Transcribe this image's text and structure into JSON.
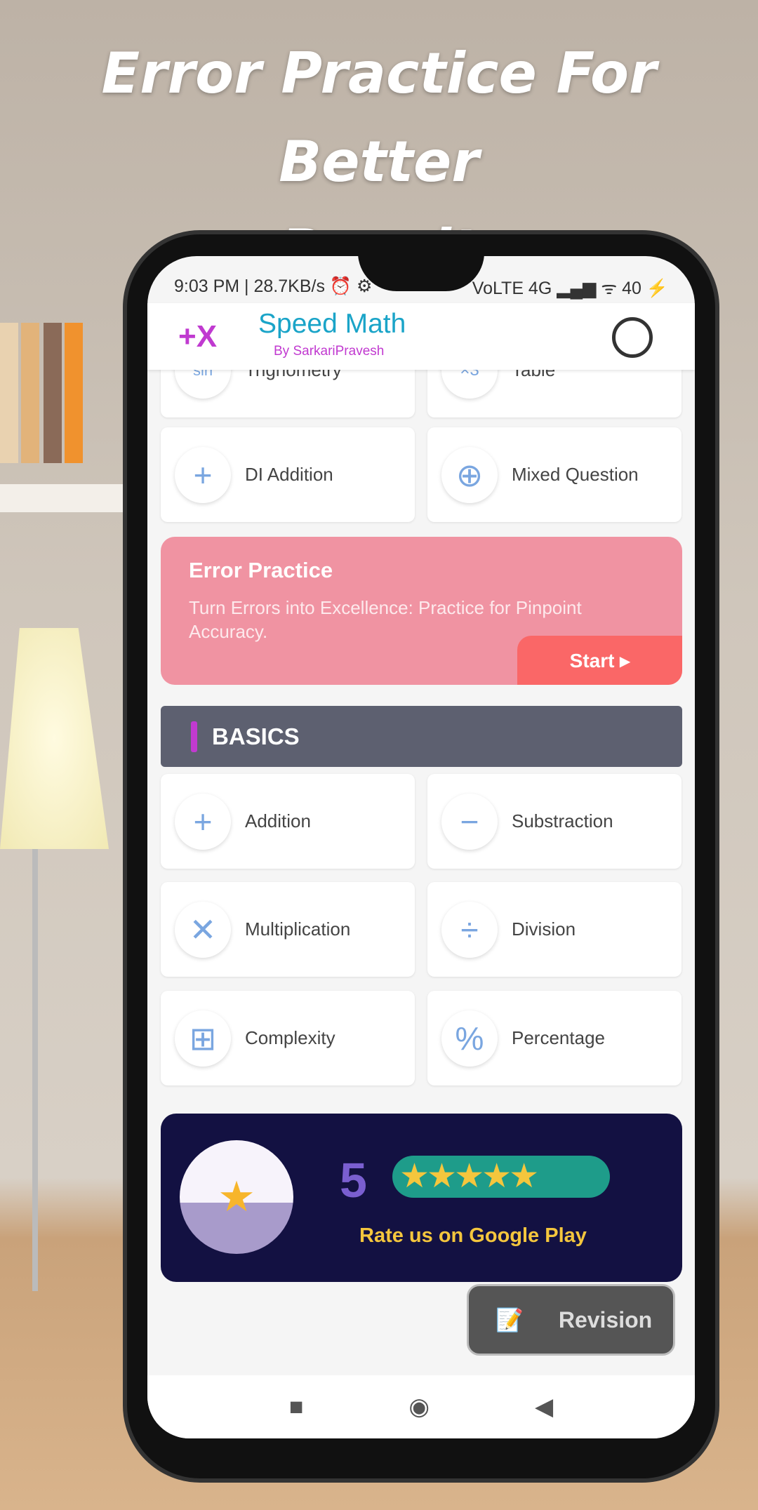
{
  "headline": {
    "line1": "Error Practice For Better",
    "line2": "Result"
  },
  "status_bar": {
    "left": "9:03 PM | 28.7KB/s ⏰ ⚙",
    "right": "VoLTE 4G ▂▄▆ ᯤ 40 ⚡",
    "battery": "40"
  },
  "app_bar": {
    "title": "Speed Math",
    "subtitle": "By SarkariPravesh",
    "logo": "+X"
  },
  "top_cards": [
    {
      "label": "Trignometry",
      "icon": "sin-icon",
      "glyph": "sin"
    },
    {
      "label": "Table",
      "icon": "table-icon",
      "glyph": "×3"
    },
    {
      "label": "DI Addition",
      "icon": "plus-icon",
      "glyph": "+"
    },
    {
      "label": "Mixed Question",
      "icon": "funnel-icon",
      "glyph": "⊕"
    }
  ],
  "error_practice": {
    "title": "Error Practice",
    "description": "Turn Errors into Excellence: Practice for Pinpoint Accuracy.",
    "start_label": "Start ▸"
  },
  "basics": {
    "header": "BASICS",
    "items": [
      {
        "label": "Addition",
        "glyph": "+"
      },
      {
        "label": "Substraction",
        "glyph": "−"
      },
      {
        "label": "Multiplication",
        "glyph": "✕"
      },
      {
        "label": "Division",
        "glyph": "÷"
      },
      {
        "label": "Complexity",
        "glyph": "⊞"
      },
      {
        "label": "Percentage",
        "glyph": "%"
      }
    ]
  },
  "banner": {
    "text": "Rate us on Google Play",
    "number": "5",
    "stars": "★★★★★"
  },
  "revision": {
    "label": "Revision",
    "icon": "📝"
  },
  "nav": {
    "square": "■",
    "circle": "◉",
    "back": "◀"
  },
  "colors": {
    "accent": "#1aa4c8",
    "brand": "#c13ad0",
    "error_card": "#f093a2",
    "start": "#fa6767",
    "basics_header": "#5d6070"
  }
}
